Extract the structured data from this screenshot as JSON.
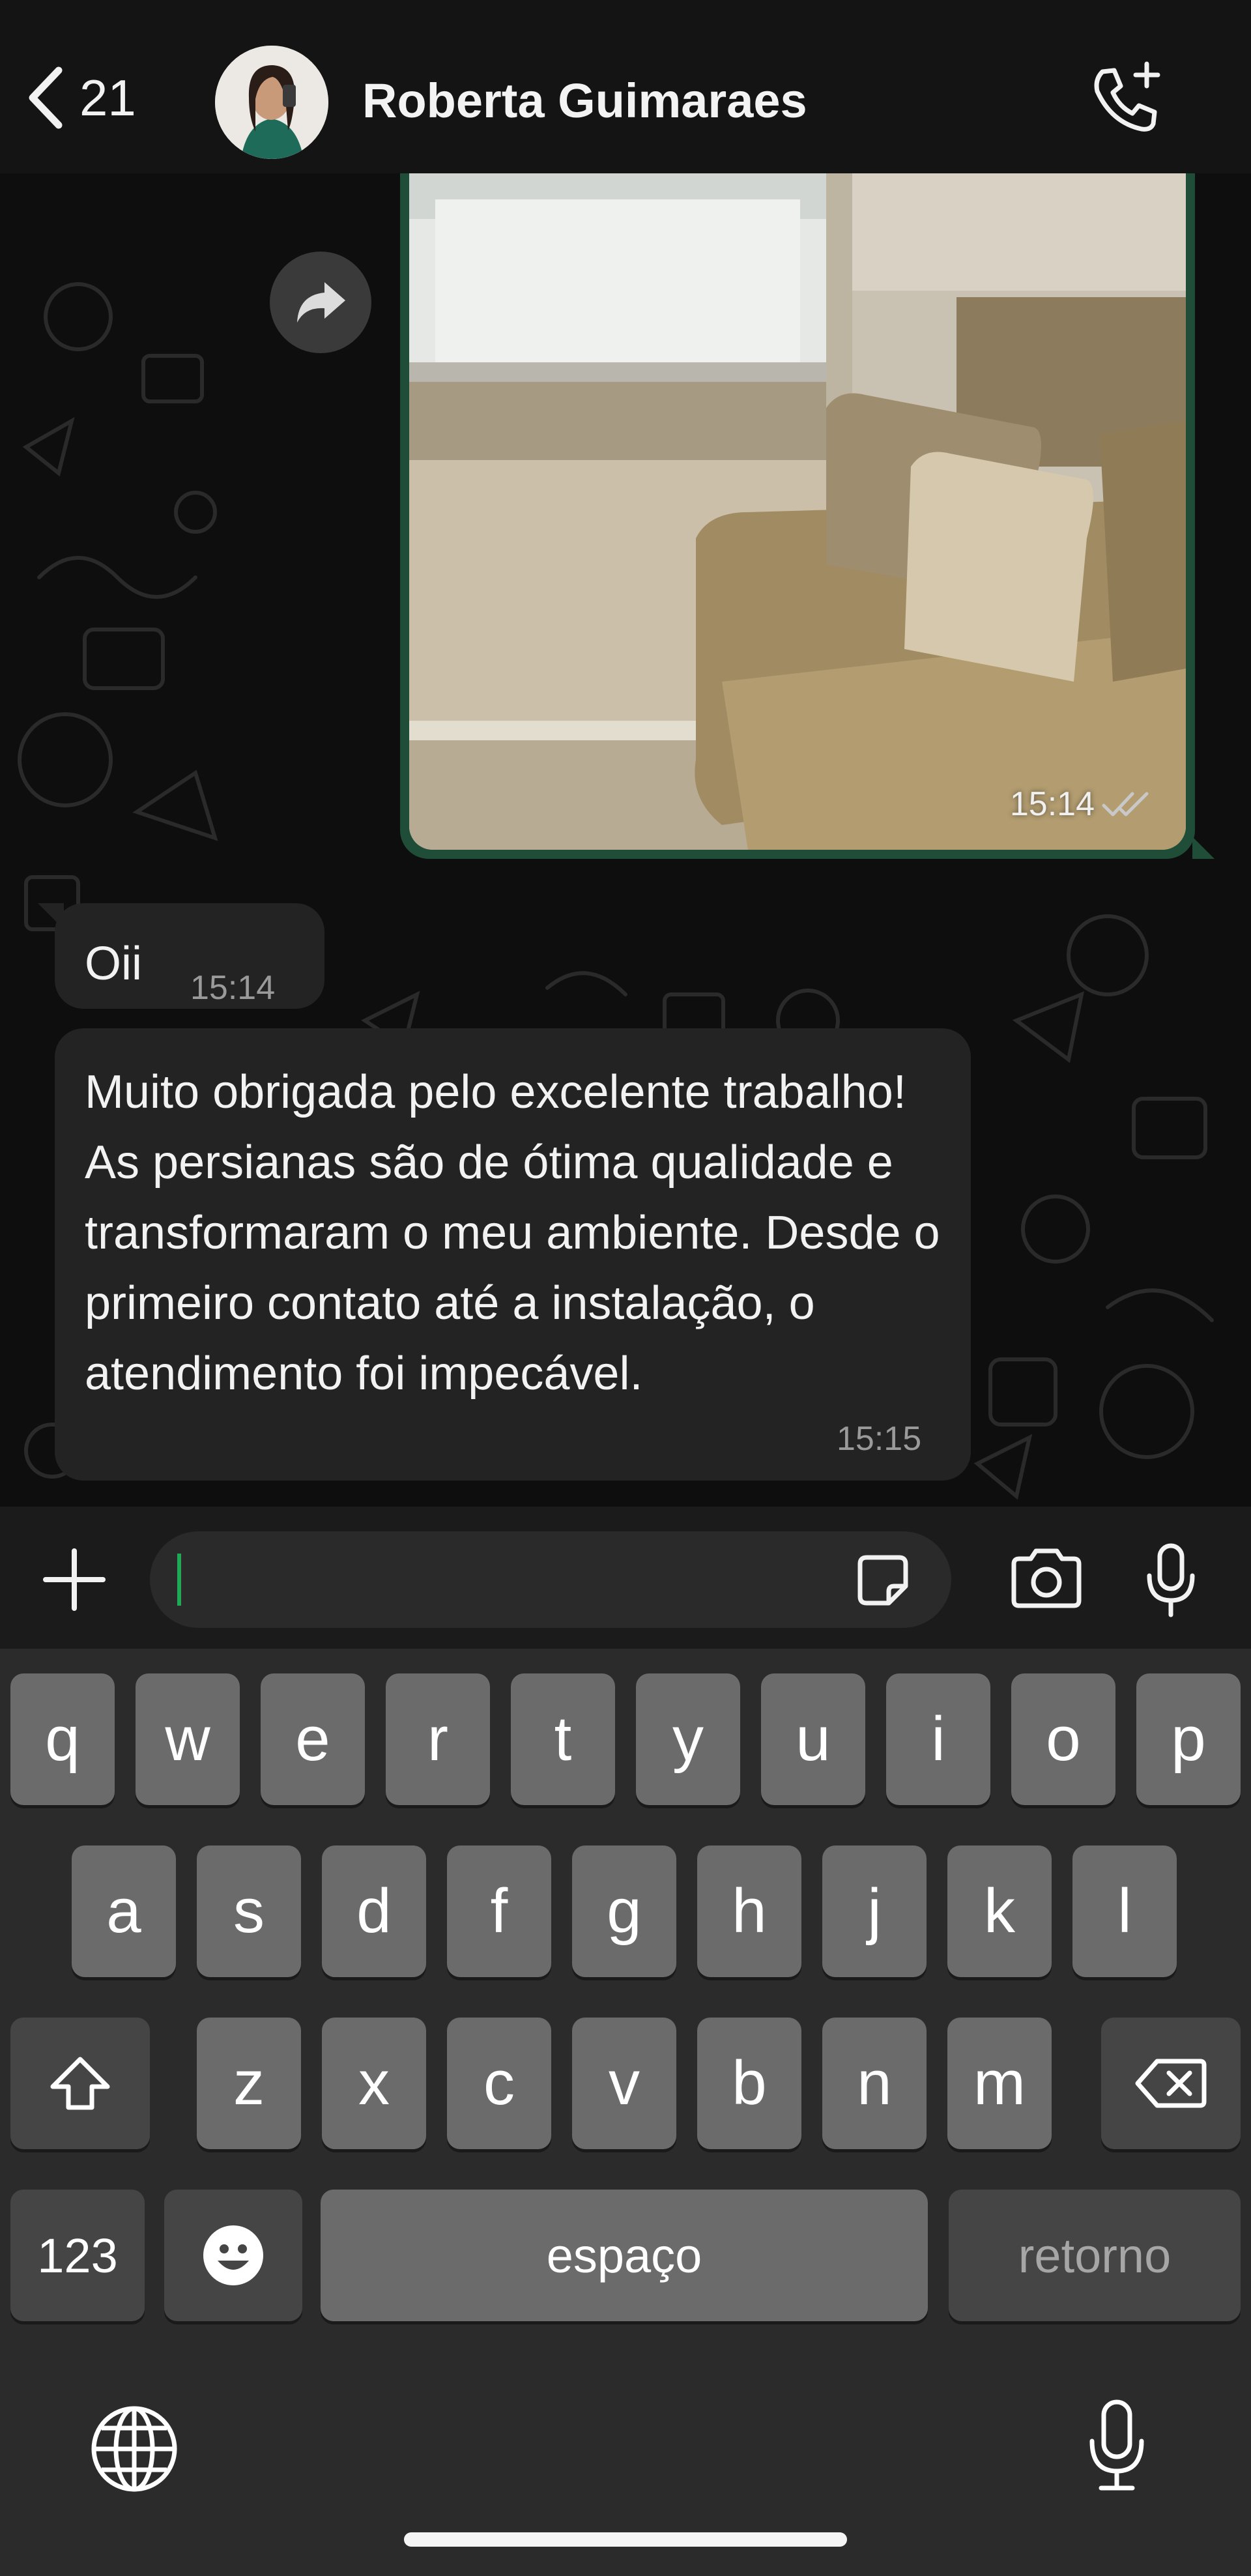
{
  "header": {
    "back_count": "21",
    "contact_name": "Roberta Guimaraes",
    "icons": [
      "chevron-left-icon",
      "avatar",
      "phone-plus-icon"
    ]
  },
  "chat": {
    "image_message": {
      "time": "15:14",
      "status": "read"
    },
    "messages": [
      {
        "text": "Oii",
        "time": "15:14"
      },
      {
        "text": "Muito obrigada pelo excelente trabalho! As persianas são de ótima qualidade e transformaram o meu ambiente. Desde o primeiro contato até a instalação, o atendimento foi impecável.",
        "time": "15:15"
      }
    ]
  },
  "input": {
    "value": ""
  },
  "keyboard": {
    "row1": [
      "q",
      "w",
      "e",
      "r",
      "t",
      "y",
      "u",
      "i",
      "o",
      "p"
    ],
    "row2": [
      "a",
      "s",
      "d",
      "f",
      "g",
      "h",
      "j",
      "k",
      "l"
    ],
    "row3": [
      "z",
      "x",
      "c",
      "v",
      "b",
      "n",
      "m"
    ],
    "numbers": "123",
    "space": "espaço",
    "return": "retorno"
  },
  "colors": {
    "outgoing": "#1f4d38",
    "incoming": "#232323",
    "accent": "#1fa855"
  }
}
